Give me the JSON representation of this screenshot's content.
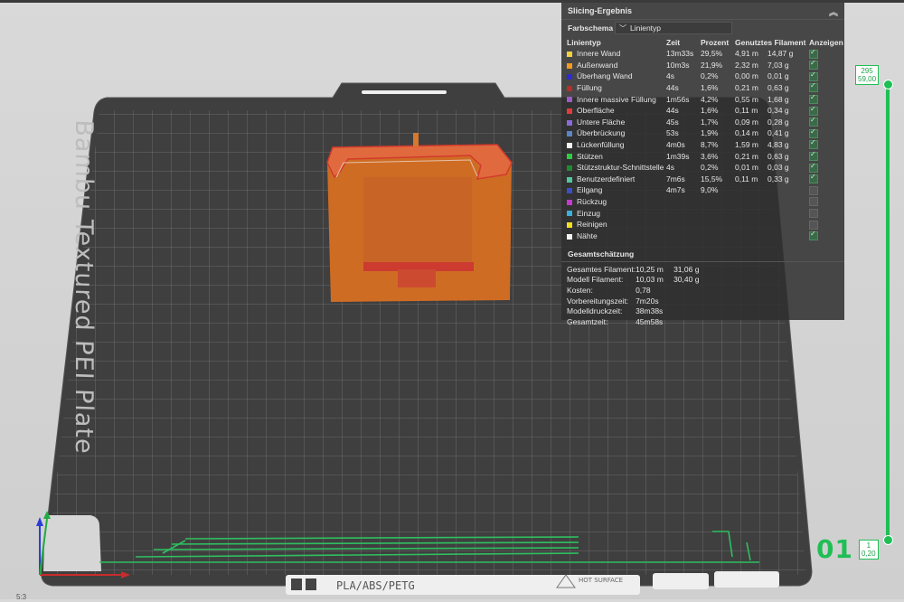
{
  "plate": {
    "name": "Bambu Textured PEI Plate",
    "filament_label": "PLA/ABS/PETG",
    "warning_label": "HOT SURFACE",
    "plate_number": "01"
  },
  "panel": {
    "title": "Slicing-Ergebnis",
    "color_scheme_label": "Farbschema",
    "color_scheme_value": "Linientyp",
    "columns": {
      "type": "Linientyp",
      "time": "Zeit",
      "percent": "Prozent",
      "filament": "Genutztes Filament",
      "show": "Anzeigen"
    },
    "rows": [
      {
        "color": "#f2d23c",
        "name": "Innere Wand",
        "time": "13m33s",
        "percent": "29,5%",
        "len": "4,91 m",
        "weight": "14,87 g",
        "show": true
      },
      {
        "color": "#f59a1e",
        "name": "Außenwand",
        "time": "10m3s",
        "percent": "21,9%",
        "len": "2,32 m",
        "weight": "7,03 g",
        "show": true
      },
      {
        "color": "#2b2bd8",
        "name": "Überhang Wand",
        "time": "4s",
        "percent": "0,2%",
        "len": "0,00 m",
        "weight": "0,01 g",
        "show": true
      },
      {
        "color": "#b5302a",
        "name": "Füllung",
        "time": "44s",
        "percent": "1,6%",
        "len": "0,21 m",
        "weight": "0,63 g",
        "show": true
      },
      {
        "color": "#9b5cc7",
        "name": "Innere massive Füllung",
        "time": "1m56s",
        "percent": "4,2%",
        "len": "0,55 m",
        "weight": "1,68 g",
        "show": true
      },
      {
        "color": "#e03c3c",
        "name": "Oberfläche",
        "time": "44s",
        "percent": "1,6%",
        "len": "0,11 m",
        "weight": "0,34 g",
        "show": true
      },
      {
        "color": "#8a6ad8",
        "name": "Untere Fläche",
        "time": "45s",
        "percent": "1,7%",
        "len": "0,09 m",
        "weight": "0,28 g",
        "show": true
      },
      {
        "color": "#5a86c4",
        "name": "Überbrückung",
        "time": "53s",
        "percent": "1,9%",
        "len": "0,14 m",
        "weight": "0,41 g",
        "show": true
      },
      {
        "color": "#f4f4f4",
        "name": "Lückenfüllung",
        "time": "4m0s",
        "percent": "8,7%",
        "len": "1,59 m",
        "weight": "4,83 g",
        "show": true
      },
      {
        "color": "#2ecc40",
        "name": "Stützen",
        "time": "1m39s",
        "percent": "3,6%",
        "len": "0,21 m",
        "weight": "0,63 g",
        "show": true
      },
      {
        "color": "#1f8a2f",
        "name": "Stützstruktur-Schnittstelle",
        "time": "4s",
        "percent": "0,2%",
        "len": "0,01 m",
        "weight": "0,03 g",
        "show": true
      },
      {
        "color": "#4fc7a0",
        "name": "Benutzerdefiniert",
        "time": "7m6s",
        "percent": "15,5%",
        "len": "0,11 m",
        "weight": "0,33 g",
        "show": true
      },
      {
        "color": "#3a4fc8",
        "name": "Eilgang",
        "time": "4m7s",
        "percent": "9,0%",
        "len": "",
        "weight": "",
        "show": false
      },
      {
        "color": "#c43ad0",
        "name": "Rückzug",
        "time": "",
        "percent": "",
        "len": "",
        "weight": "",
        "show": false
      },
      {
        "color": "#3ab0d8",
        "name": "Einzug",
        "time": "",
        "percent": "",
        "len": "",
        "weight": "",
        "show": false
      },
      {
        "color": "#f0e020",
        "name": "Reinigen",
        "time": "",
        "percent": "",
        "len": "",
        "weight": "",
        "show": false
      },
      {
        "color": "#f4f4f4",
        "name": "Nähte",
        "time": "",
        "percent": "",
        "len": "",
        "weight": "",
        "show": true
      }
    ],
    "summary_title": "Gesamtschätzung",
    "summary": [
      {
        "label": "Gesamtes Filament:",
        "v1": "10,25 m",
        "v2": "31,06 g"
      },
      {
        "label": "Modell Filament:",
        "v1": "10,03 m",
        "v2": "30,40 g"
      },
      {
        "label": "Kosten:",
        "v1": "0,78",
        "v2": ""
      },
      {
        "label": "Vorbereitungszeit:",
        "v1": "7m20s",
        "v2": ""
      },
      {
        "label": "Modelldruckzeit:",
        "v1": "38m38s",
        "v2": ""
      },
      {
        "label": "Gesamtzeit:",
        "v1": "45m58s",
        "v2": ""
      }
    ]
  },
  "slider": {
    "top_layer": "295",
    "top_height": "59,00",
    "bottom_layer": "1",
    "bottom_height": "0,20",
    "accent": "#1fbf55"
  },
  "zoom_label": "5:3"
}
